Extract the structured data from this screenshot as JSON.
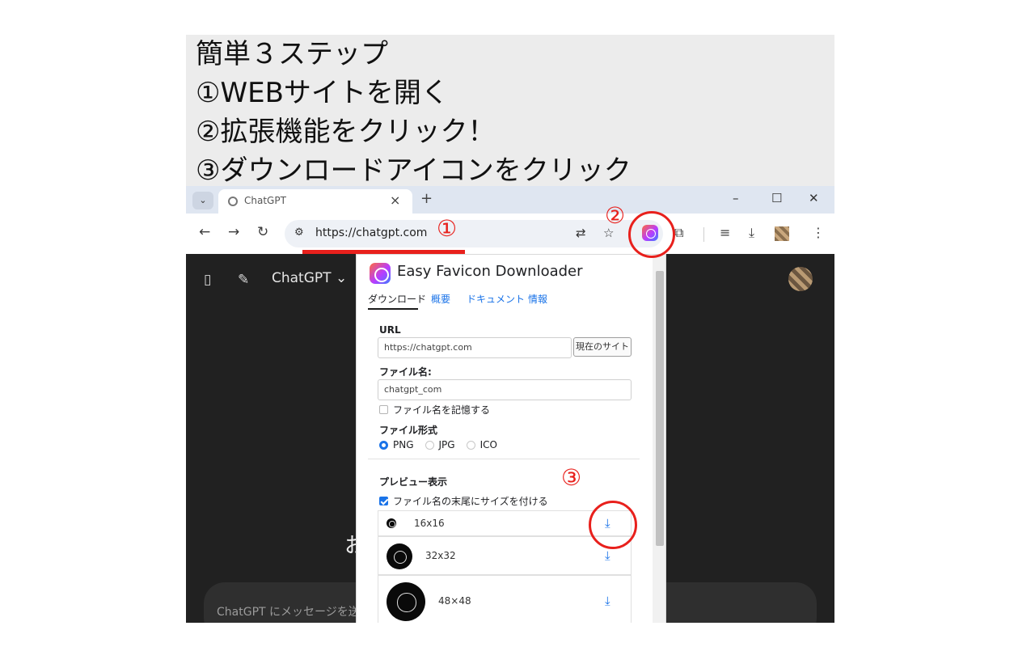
{
  "instructions": {
    "line1": "簡単３ステップ",
    "line2": "①WEBサイトを開く",
    "line3": "②拡張機能をクリック！",
    "line4": "③ダウンロードアイコンをクリック"
  },
  "browser": {
    "tab_title": "ChatGPT",
    "url": "https://chatgpt.com"
  },
  "chatgpt": {
    "model_label": "ChatGPT ⌄",
    "greeting_fragment": "お",
    "input_placeholder": "ChatGPT にメッセージを送信"
  },
  "popup": {
    "title": "Easy Favicon Downloader",
    "tabs": [
      "ダウンロード",
      "概要",
      "ドキュメント",
      "情報"
    ],
    "url_label": "URL",
    "url_value": "https://chatgpt.com",
    "current_site_button": "現在のサイト",
    "filename_label": "ファイル名:",
    "filename_value": "chatgpt_com",
    "remember_filename": "ファイル名を記憶する",
    "format_label": "ファイル形式",
    "formats": [
      "PNG",
      "JPG",
      "ICO"
    ],
    "selected_format": "PNG",
    "preview_label": "プレビュー表示",
    "append_size": "ファイル名の末尾にサイズを付ける",
    "append_size_checked": true,
    "sizes": [
      "16x16",
      "32x32",
      "48×48"
    ]
  },
  "annotations": {
    "one": "①",
    "two": "②",
    "three": "③"
  },
  "colors": {
    "annotation_red": "#e8201c",
    "link_blue": "#1a73e8",
    "chat_bg": "#212121"
  }
}
